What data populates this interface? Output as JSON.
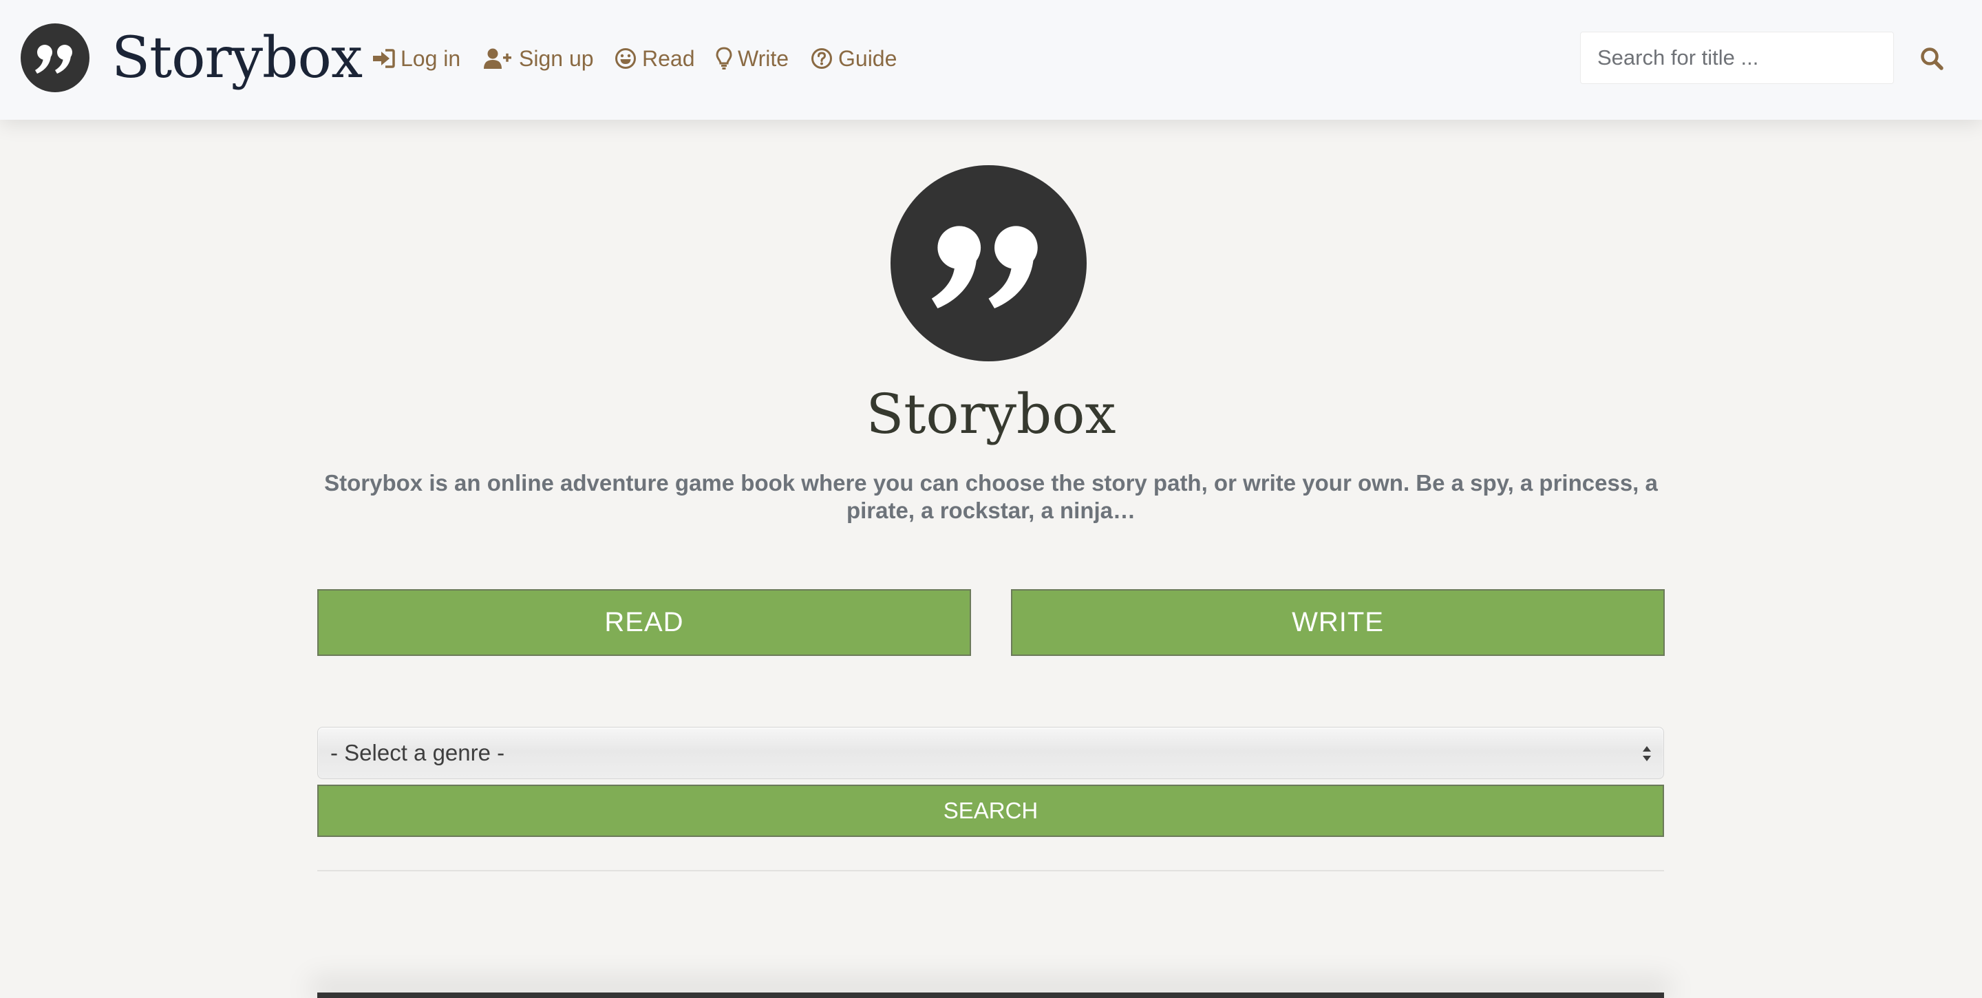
{
  "header": {
    "brand_name": "Storybox",
    "nav": [
      {
        "label": "Log in",
        "icon": "sign-in-icon"
      },
      {
        "label": "Sign up",
        "icon": "user-plus-icon"
      },
      {
        "label": "Read",
        "icon": "smile-icon"
      },
      {
        "label": "Write",
        "icon": "lightbulb-icon"
      },
      {
        "label": "Guide",
        "icon": "question-circle-icon"
      }
    ],
    "search": {
      "placeholder": "Search for title ...",
      "value": "",
      "icon": "search-icon"
    }
  },
  "hero": {
    "title": "Storybox",
    "description": "Storybox is an online adventure game book where you can choose the story path, or write your own. Be a spy, a princess, a pirate, a rockstar, a ninja…"
  },
  "actions": {
    "read_label": "READ",
    "write_label": "WRITE"
  },
  "genre_filter": {
    "selected": "- Select a genre -",
    "search_label": "SEARCH"
  },
  "colors": {
    "nav_link": "#8a6a43",
    "button_green": "#80ad55",
    "logo_dark": "#333333",
    "title_dark": "#1b2436",
    "page_bg": "#f5f4f2"
  }
}
